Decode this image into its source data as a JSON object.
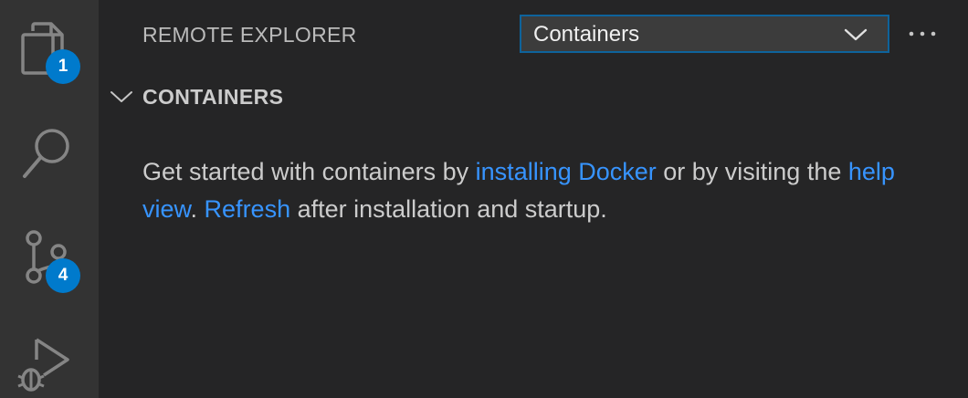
{
  "activity_bar": {
    "items": [
      {
        "icon": "files-icon",
        "badge": "1"
      },
      {
        "icon": "search-icon",
        "badge": ""
      },
      {
        "icon": "source-control-icon",
        "badge": "4"
      },
      {
        "icon": "run-debug-icon",
        "badge": ""
      }
    ]
  },
  "sidebar": {
    "title": "REMOTE EXPLORER",
    "view_select": {
      "selected": "Containers"
    },
    "more_actions": "···"
  },
  "section": {
    "title": "CONTAINERS",
    "welcome": {
      "text_1": "Get started with containers by ",
      "link_install": "installing Docker",
      "text_2": " or by visiting the ",
      "link_help": "help view",
      "text_3": ". ",
      "link_refresh": "Refresh",
      "text_4": " after installation and startup."
    }
  },
  "colors": {
    "activity_bar_bg": "#333333",
    "sidebar_bg": "#252526",
    "badge_bg": "#007acc",
    "link": "#3794ff",
    "focus_border": "#0e639c"
  }
}
